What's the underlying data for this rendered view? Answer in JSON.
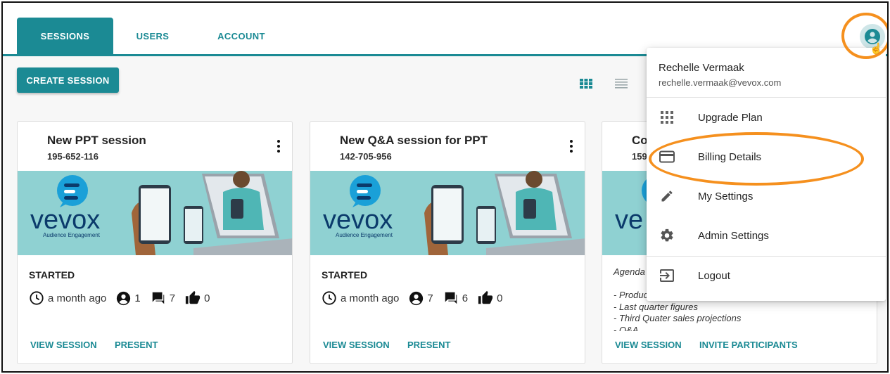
{
  "tabs": [
    {
      "label": "SESSIONS",
      "active": true
    },
    {
      "label": "USERS",
      "active": false
    },
    {
      "label": "ACCOUNT",
      "active": false
    }
  ],
  "toolbar": {
    "create_label": "CREATE SESSION"
  },
  "icons": {
    "grid_view": "grid-view-icon",
    "list_view": "list-view-icon"
  },
  "colors": {
    "accent": "#1b8a94",
    "highlight": "#f5901e"
  },
  "cards": [
    {
      "title": "New PPT session",
      "code": "195-652-116",
      "status": "STARTED",
      "time": "a month ago",
      "participants": "1",
      "questions": "7",
      "likes": "0",
      "links": [
        "VIEW SESSION",
        "PRESENT"
      ],
      "brand": "vevox",
      "brand_tagline": "Audience Engagement"
    },
    {
      "title": "New Q&A session for PPT",
      "code": "142-705-956",
      "status": "STARTED",
      "time": "a month ago",
      "participants": "7",
      "questions": "6",
      "likes": "0",
      "links": [
        "VIEW SESSION",
        "PRESENT"
      ],
      "brand": "vevox",
      "brand_tagline": "Audience Engagement"
    },
    {
      "title": "Co",
      "code": "159",
      "agenda": [
        "Agenda",
        "",
        "- Produc",
        "- Last quarter figures",
        "- Third Quater sales projections",
        "- Q&A"
      ],
      "links": [
        "VIEW SESSION",
        "INVITE PARTICIPANTS"
      ],
      "brand": "ve"
    }
  ],
  "user_menu": {
    "name": "Rechelle Vermaak",
    "email": "rechelle.vermaak@vevox.com",
    "items": [
      {
        "label": "Upgrade Plan",
        "icon": "apps-grid-icon"
      },
      {
        "label": "Billing Details",
        "icon": "credit-card-icon"
      },
      {
        "label": "My Settings",
        "icon": "pencil-icon"
      },
      {
        "label": "Admin Settings",
        "icon": "gear-icon"
      },
      {
        "label": "Logout",
        "icon": "logout-icon"
      }
    ]
  }
}
